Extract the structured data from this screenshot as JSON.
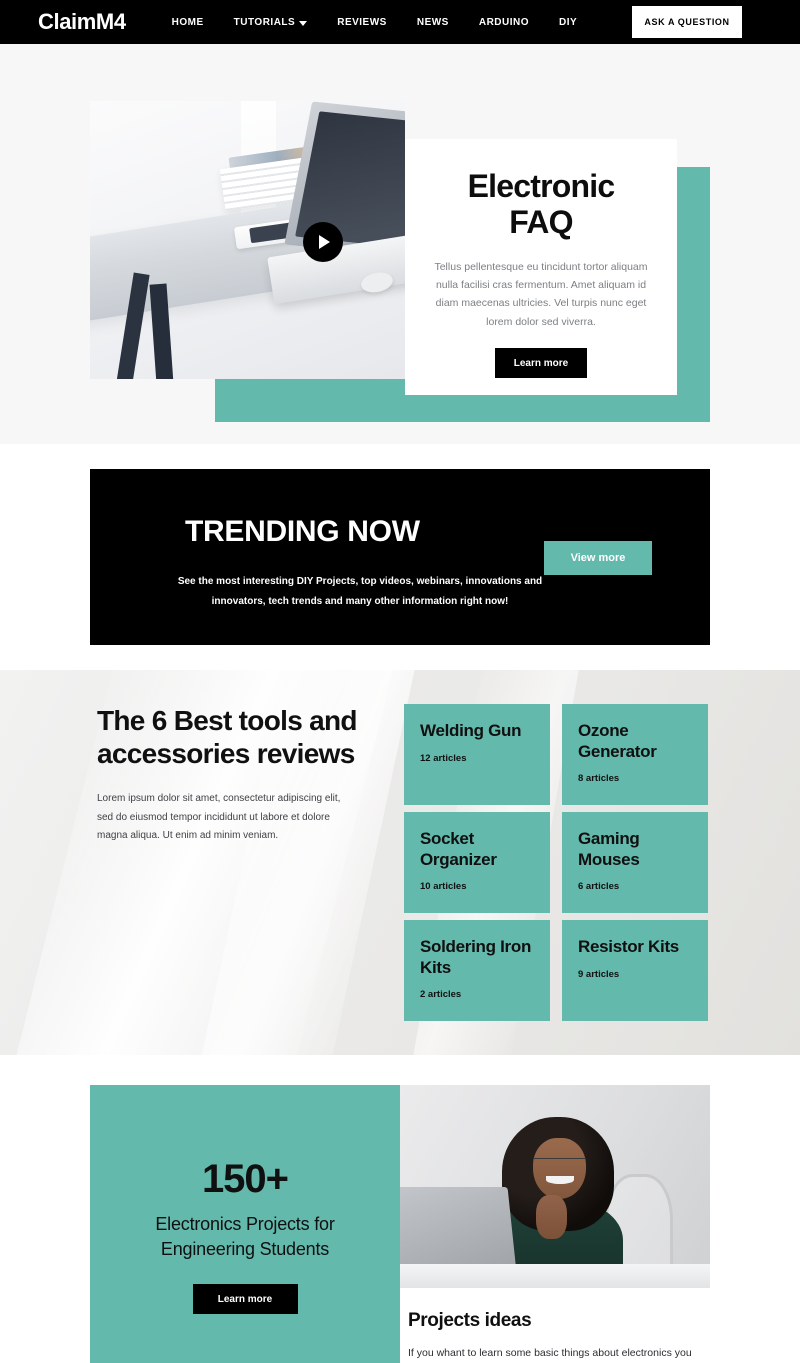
{
  "header": {
    "logo": "ClaimM4",
    "nav": [
      {
        "label": "HOME",
        "has_caret": false
      },
      {
        "label": "TUTORIALS",
        "has_caret": true
      },
      {
        "label": "REVIEWS",
        "has_caret": false
      },
      {
        "label": "NEWS",
        "has_caret": false
      },
      {
        "label": "ARDUINO",
        "has_caret": false
      },
      {
        "label": "DIY",
        "has_caret": false
      }
    ],
    "cta_label": "ASK A QUESTION"
  },
  "hero": {
    "title_line1": "Electronic",
    "title_line2": "FAQ",
    "description": "Tellus pellentesque eu tincidunt tortor aliquam nulla facilisi cras fermentum. Amet aliquam id diam maecenas ultricies. Vel turpis nunc eget lorem dolor sed viverra.",
    "button_label": "Learn more",
    "play_icon": "play-icon"
  },
  "trending": {
    "title": "TRENDING NOW",
    "description": "See  the most interesting DIY Projects, top videos, webinars, innovations and innovators, tech trends and many other information right now!",
    "button_label": "View more"
  },
  "tools": {
    "heading": "The 6 Best tools and accessories reviews",
    "paragraph": "Lorem ipsum dolor sit amet, consectetur adipiscing elit, sed do eiusmod tempor incididunt ut labore et dolore magna aliqua. Ut enim ad minim veniam.",
    "tiles": [
      {
        "title": "Welding Gun",
        "count": "12 articles"
      },
      {
        "title": "Ozone Generator",
        "count": "8 articles"
      },
      {
        "title": "Socket Organizer",
        "count": "10 articles"
      },
      {
        "title": "Gaming Mouses",
        "count": "6 articles"
      },
      {
        "title": "Soldering Iron Kits",
        "count": "2 articles"
      },
      {
        "title": "Resistor Kits",
        "count": "9 articles"
      }
    ]
  },
  "projects": {
    "number": "150+",
    "subtitle": "Electronics Projects for Engineering Students",
    "button_label": "Learn more",
    "ideas_title": "Projects ideas",
    "ideas_text": "If you whant to learn some basic things about electronics you"
  },
  "colors": {
    "accent_teal": "#63b9ac",
    "black": "#000000",
    "hero_bg": "#f7f7f7",
    "muted_text": "#7c7f84"
  }
}
